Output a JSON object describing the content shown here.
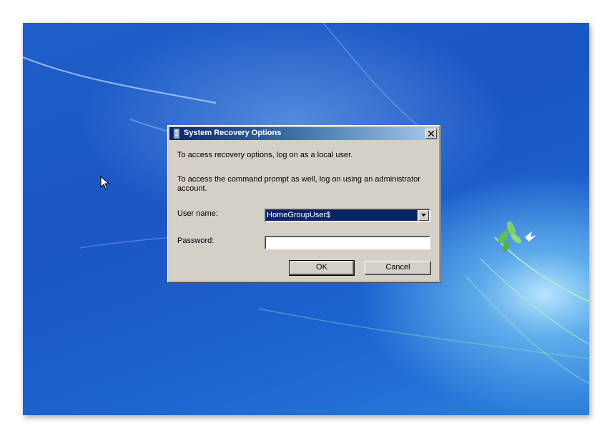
{
  "dialog": {
    "title": "System Recovery Options",
    "message_local": "To access recovery options, log on as a local user.",
    "message_admin": "To access the command prompt as well, log on using an administrator account.",
    "user_label": "User name:",
    "user_value": "HomeGroupUser$",
    "password_label": "Password:",
    "password_value": "",
    "ok_label": "OK",
    "cancel_label": "Cancel"
  },
  "icons": {
    "title": "recovery-icon",
    "close": "close-icon",
    "dropdown": "chevron-down-icon",
    "cursor": "mouse-pointer-icon"
  },
  "colors": {
    "desktop": "#1a56c4",
    "dialog_face": "#d4d0c8",
    "titlebar_start": "#0a246a",
    "titlebar_end": "#a6caf0",
    "selection": "#0a246a"
  }
}
